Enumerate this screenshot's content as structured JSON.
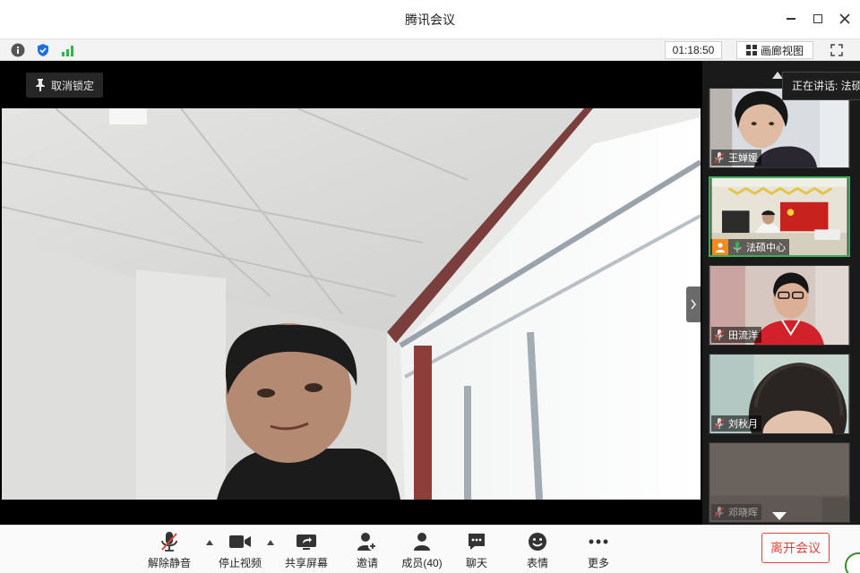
{
  "window": {
    "title": "腾讯会议"
  },
  "infobar": {
    "timer": "01:18:50",
    "gallery_label": "画廊视图"
  },
  "main": {
    "unpin_label": "取消锁定"
  },
  "side": {
    "speaking_prefix": "正在讲话: 法硕",
    "participants": [
      {
        "name": "王婵媛"
      },
      {
        "name": "法硕中心"
      },
      {
        "name": "田流洋"
      },
      {
        "name": "刘秋月"
      },
      {
        "name": "邓晓晖"
      }
    ]
  },
  "toolbar": {
    "unmute": "解除静音",
    "stop_video": "停止视频",
    "share_screen": "共享屏幕",
    "invite": "邀请",
    "members": "成员(40)",
    "chat": "聊天",
    "reactions": "表情",
    "more": "更多",
    "leave": "离开会议"
  },
  "colors": {
    "accent_green": "#3dae5c",
    "leave_red": "#e0433a",
    "host_orange": "#f08a1c"
  }
}
